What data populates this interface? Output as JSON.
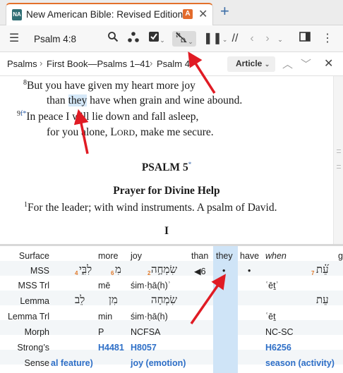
{
  "tab": {
    "title": "New American Bible: Revised Edition",
    "badge": "A",
    "close": "✕",
    "new_tab": "+"
  },
  "toolbar": {
    "reference": "Psalm 4:8"
  },
  "breadcrumb": {
    "items": [
      "Psalms",
      "First Book—Psalms 1–41",
      "Psalm 4"
    ],
    "article_label": "Article"
  },
  "text": {
    "v8_num": "8",
    "v8_line1": "But you have given my heart more joy",
    "v8_line2_pre": "than ",
    "v8_line2_hl": "they",
    "v8_line2_post": " have when grain and wine abound.",
    "v9_num": "9",
    "v9_note": "f*",
    "v9_line1": "In peace I will lie down and fall asleep,",
    "v9_line2_pre": "for you alone, L",
    "v9_line2_sc": "ORD",
    "v9_line2_post": ", make me secure.",
    "psalm_title": "PSALM 5",
    "psalm_star": "*",
    "psalm_subtitle": "Prayer for Divine Help",
    "p5_v1_num": "1",
    "p5_v1": "For the leader; with wind instruments. A psalm of David.",
    "section": "I"
  },
  "interlinear": {
    "row_labels": [
      "Surface",
      "MSS",
      "MSS Trl",
      "Lemma",
      "Lemma Trl",
      "Morph",
      "Strong’s",
      "Sense"
    ],
    "surface": [
      "more",
      "joy",
      "than",
      "they",
      "have",
      "when",
      "g"
    ],
    "mss": [
      "לִבִּ֑י",
      "4",
      "מִ",
      "6",
      "שִׂמְחָ֣ה",
      "2",
      "◀6",
      "•",
      "•",
      "עֵ֝֗ת",
      "7"
    ],
    "mss_trl": [
      "mē",
      "śim·ḥā(h)ʾ",
      "ʿēṯʾ"
    ],
    "lemma": [
      "לֵב",
      "מִן",
      "שִׂמְחָה",
      "עֵת"
    ],
    "lemma_trl": [
      "min",
      "śim·ḥā(h)",
      "ʿēṯ"
    ],
    "morph": [
      "P",
      "NCFSA",
      "NC-SC"
    ],
    "strongs": [
      "H4481",
      "H8057",
      "H6256"
    ],
    "sense": [
      "al feature)",
      "joy (emotion)",
      "season (activity)"
    ]
  },
  "colors": {
    "accent": "#e3702a",
    "link": "#2e6fc7",
    "highlight": "#cfe4f7",
    "arrow": "#e01b24"
  }
}
